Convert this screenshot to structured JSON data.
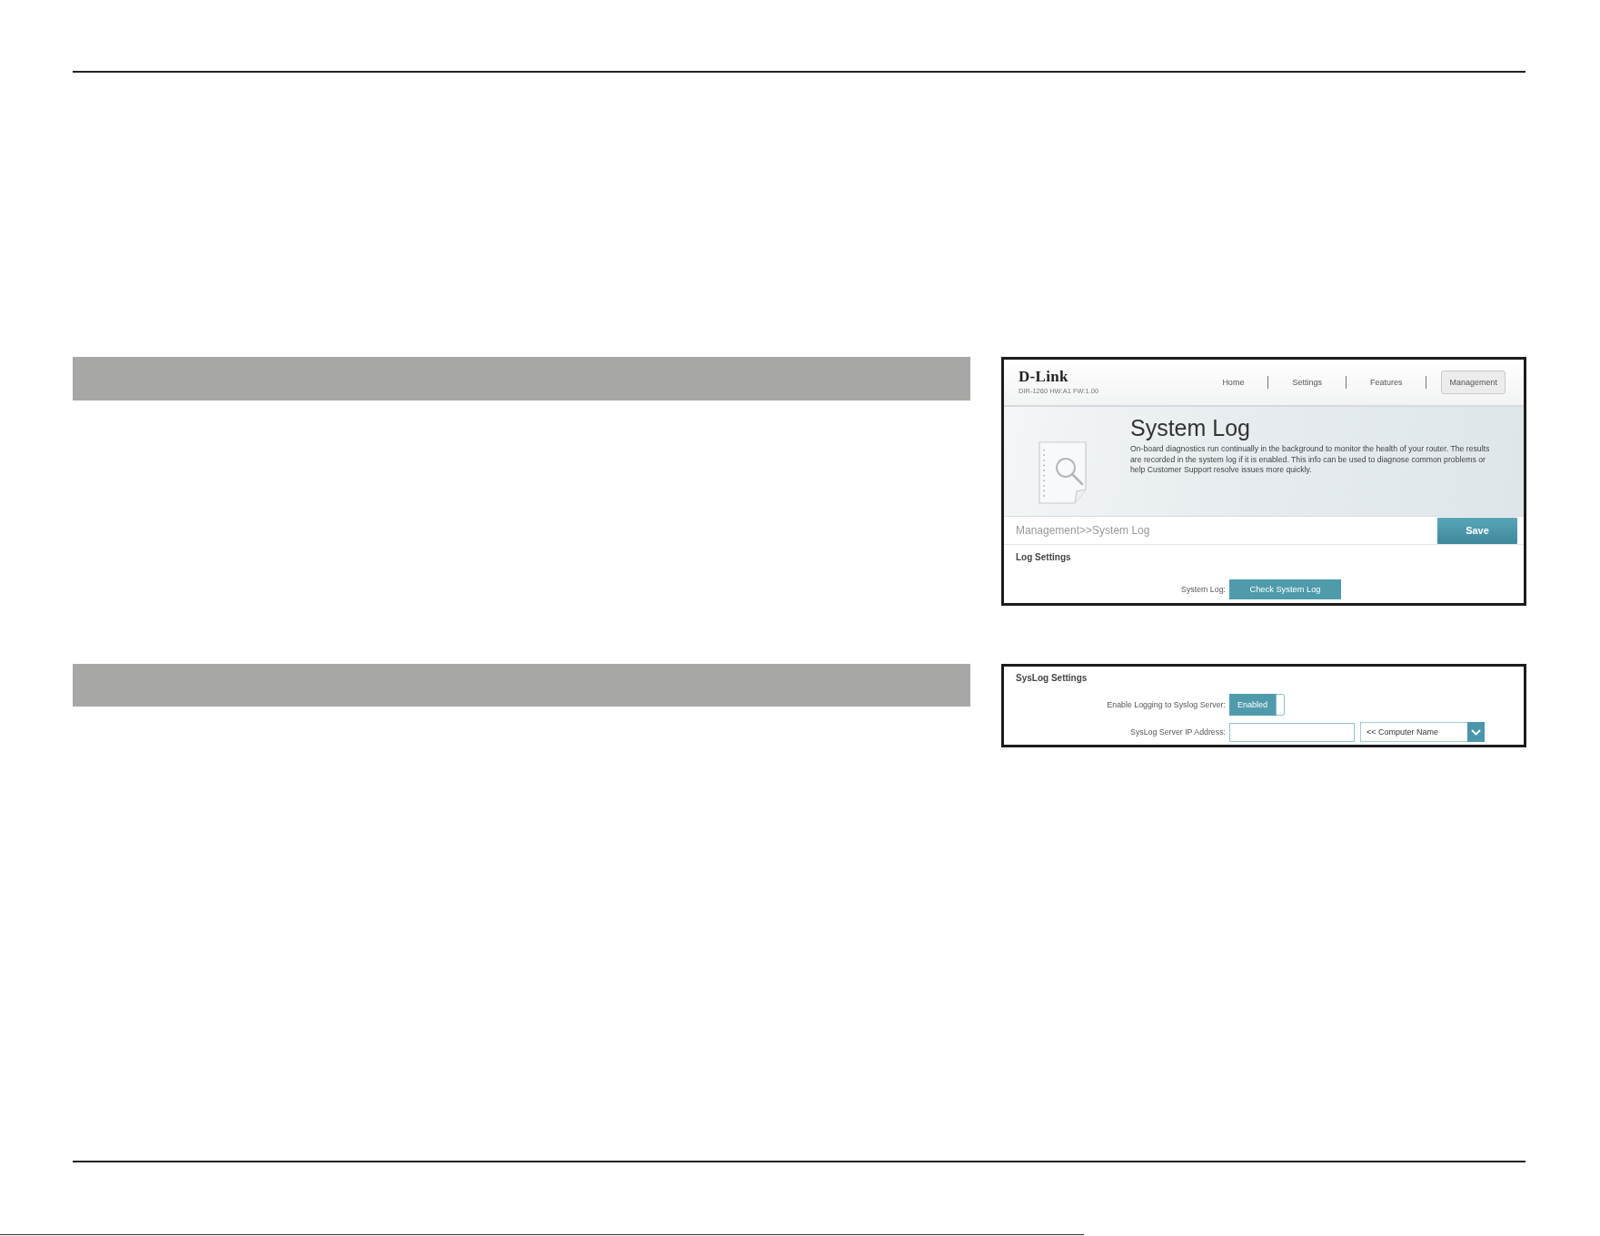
{
  "sections": [
    {
      "kind": "system_log",
      "header": {
        "logo": "D-Link",
        "model": "DIR-1260 HW:A1 FW:1.00",
        "nav": [
          {
            "label": "Home",
            "selected": false
          },
          {
            "label": "Settings",
            "selected": false
          },
          {
            "label": "Features",
            "selected": false
          },
          {
            "label": "Management",
            "selected": true
          }
        ]
      },
      "hero": {
        "title": "System Log",
        "description": "On-board diagnostics run continually in the background to monitor the health of your router. The results are recorded in the system log if it is enabled. This info can be used to diagnose common problems or help Customer Support resolve issues more quickly."
      },
      "breadcrumb": "Management>>System Log",
      "save_button": "Save",
      "group_title": "Log Settings",
      "rows": [
        {
          "kind": "button",
          "label": "System Log:",
          "button": "Check System Log"
        }
      ]
    },
    {
      "kind": "syslog",
      "group_title": "SysLog Settings",
      "rows": [
        {
          "kind": "toggle",
          "label": "Enable Logging to Syslog Server:",
          "value": "Enabled",
          "on": true
        },
        {
          "kind": "address",
          "label": "SysLog Server IP Address:",
          "select": "<< Computer Name"
        }
      ]
    }
  ]
}
